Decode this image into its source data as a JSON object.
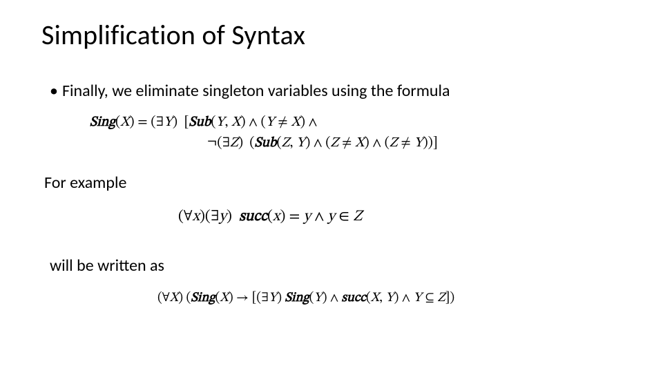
{
  "title": "Simplification of Syntax",
  "bullet": {
    "marker": "•",
    "text": "Finally, we eliminate singleton variables using the formula"
  },
  "formula1_line1": "Sing(X) = (∃Y)  [Sub(Y, X) ∧ (Y ≠ X) ∧",
  "formula1_line2": "¬(∃Z)  (Sub(Z, Y) ∧ (Z ≠ X) ∧ (Z ≠ Y))]",
  "for_example": "For example",
  "formula2": "(∀x)(∃y)  succ(x) = y ∧ y ∈ Z",
  "will_be_written": "will be written as",
  "formula3": "(∀X) (Sing(X) → [(∃Y) Sing(Y) ∧ succ(X, Y) ∧ Y ⊆ Z])"
}
